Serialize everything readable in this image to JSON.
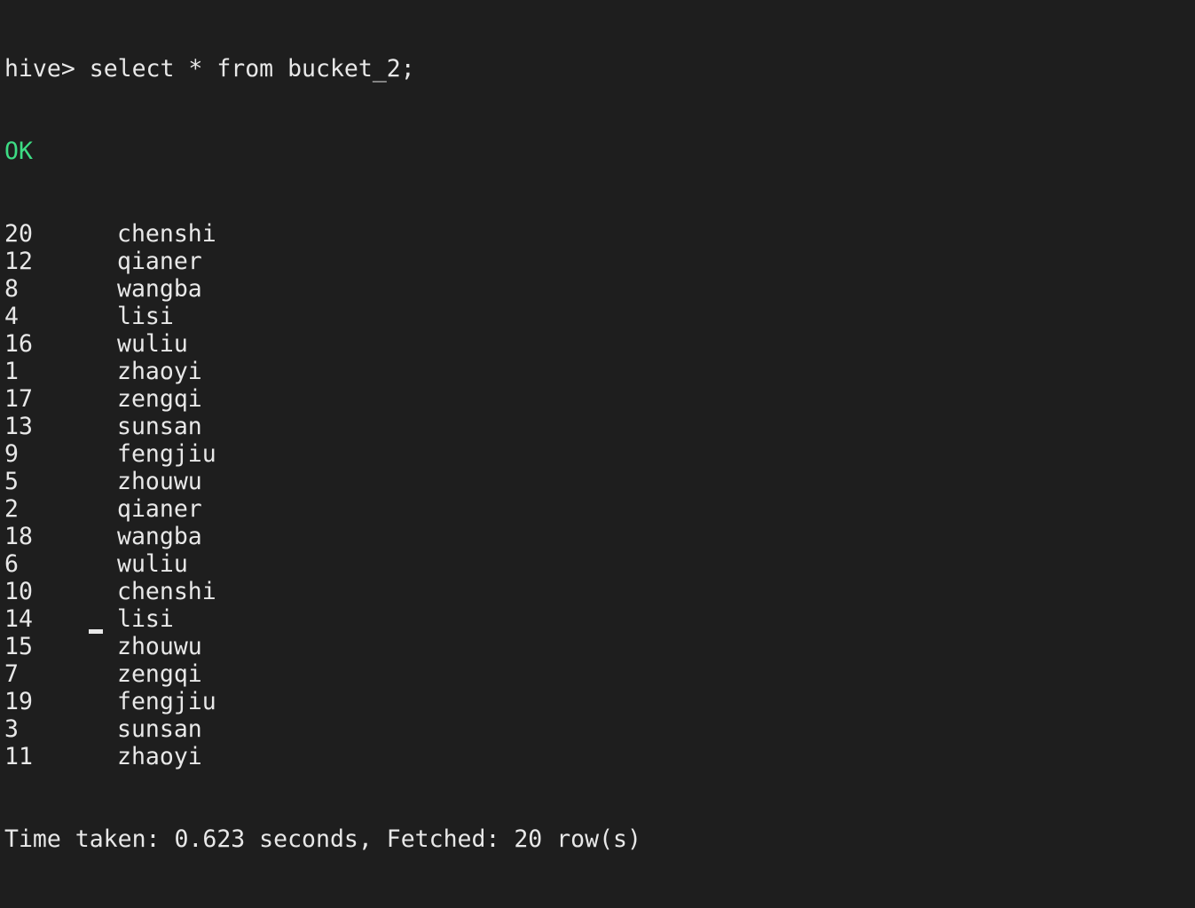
{
  "terminal": {
    "prompt": "hive> ",
    "command": "select * from bucket_2;",
    "status": "OK",
    "rows": [
      {
        "id": "20",
        "name": "chenshi"
      },
      {
        "id": "12",
        "name": "qianer"
      },
      {
        "id": "8",
        "name": "wangba"
      },
      {
        "id": "4",
        "name": "lisi"
      },
      {
        "id": "16",
        "name": "wuliu"
      },
      {
        "id": "1",
        "name": "zhaoyi"
      },
      {
        "id": "17",
        "name": "zengqi"
      },
      {
        "id": "13",
        "name": "sunsan"
      },
      {
        "id": "9",
        "name": "fengjiu"
      },
      {
        "id": "5",
        "name": "zhouwu"
      },
      {
        "id": "2",
        "name": "qianer"
      },
      {
        "id": "18",
        "name": "wangba"
      },
      {
        "id": "6",
        "name": "wuliu"
      },
      {
        "id": "10",
        "name": "chenshi"
      },
      {
        "id": "14",
        "name": "lisi"
      },
      {
        "id": "15",
        "name": "zhouwu"
      },
      {
        "id": "7",
        "name": "zengqi"
      },
      {
        "id": "19",
        "name": "fengjiu"
      },
      {
        "id": "3",
        "name": "sunsan"
      },
      {
        "id": "11",
        "name": "zhaoyi"
      }
    ],
    "summary": "Time taken: 0.623 seconds, Fetched: 20 row(s)"
  },
  "colors": {
    "background": "#1e1e1e",
    "text": "#e8e8e8",
    "ok": "#3ddc84"
  }
}
